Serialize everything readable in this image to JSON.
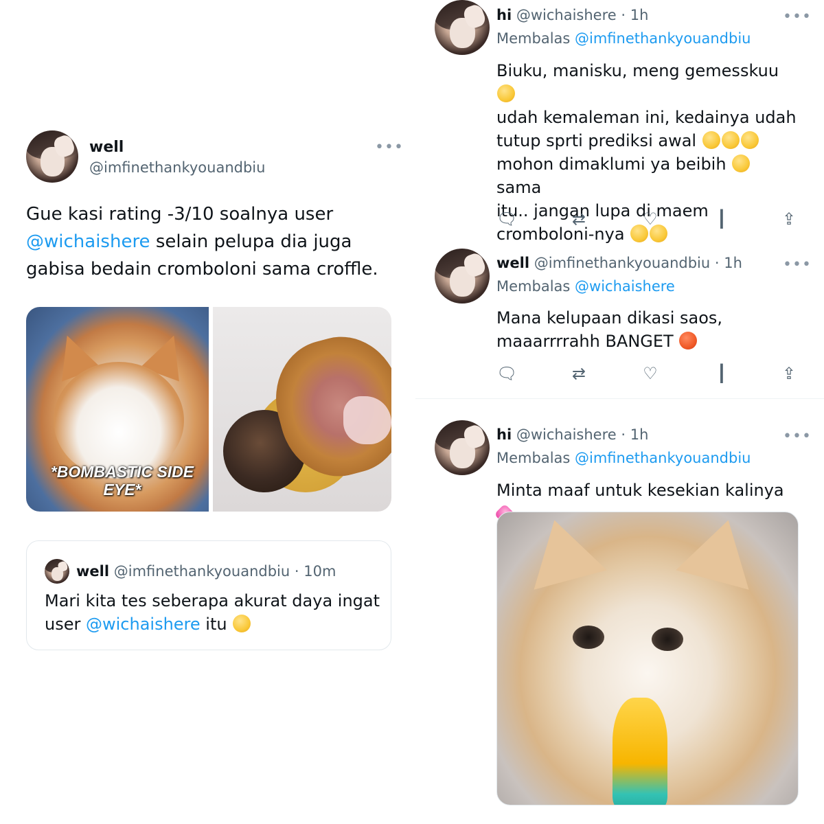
{
  "left_tweet": {
    "name": "well",
    "handle": "@imfinethankyouandbiu",
    "more": "•••",
    "text_part1": "Gue kasi rating -3/10 soalnya user ",
    "mention": "@wichaishere",
    "text_part2": " selain pelupa dia juga gabisa bedain cromboloni sama croffle.",
    "media_caption": "*BOMBASTIC SIDE EYE*",
    "quote": {
      "name": "well",
      "handle": "@imfinethankyouandbiu",
      "sep": "·",
      "time": "10m",
      "text_part1": "Mari kita tes seberapa akurat daya ingat user ",
      "mention": "@wichaishere",
      "text_part2": " itu"
    }
  },
  "right_tweets": [
    {
      "name": "hi",
      "handle": "@wichaishere",
      "sep": "·",
      "time": "1h",
      "more": "•••",
      "replying_prefix": "Membalas ",
      "replying_to": "@imfinethankyouandbiu",
      "line1": "Biuku, manisku, meng gemesskuu",
      "line2": "udah kemaleman ini, kedainya udah",
      "line3": "tutup sprti prediksi awal",
      "line4a": "mohon dimaklumi ya beibih",
      "line4b": "sama",
      "line5": "itu.. jangan lupa di maem",
      "line6": "cromboloni-nya"
    },
    {
      "name": "well",
      "handle": "@imfinethankyouandbiu",
      "sep": "·",
      "time": "1h",
      "more": "•••",
      "replying_prefix": "Membalas ",
      "replying_to": "@wichaishere",
      "line1": "Mana kelupaan dikasi saos,",
      "line2": "maaarrrrahh BANGET"
    },
    {
      "name": "hi",
      "handle": "@wichaishere",
      "sep": "·",
      "time": "1h",
      "more": "•••",
      "replying_prefix": "Membalas ",
      "replying_to": "@imfinethankyouandbiu",
      "line1": "Minta maaf untuk kesekian kalinya"
    }
  ],
  "actions": {
    "reply_icon": "speech-bubble-icon",
    "retweet_icon": "retweet-icon",
    "like_icon": "heart-icon",
    "views_icon": "bar-chart-icon",
    "share_icon": "share-icon"
  },
  "colors": {
    "link": "#1d9bf0",
    "secondary_text": "#536471",
    "primary_text": "#0f1419"
  }
}
